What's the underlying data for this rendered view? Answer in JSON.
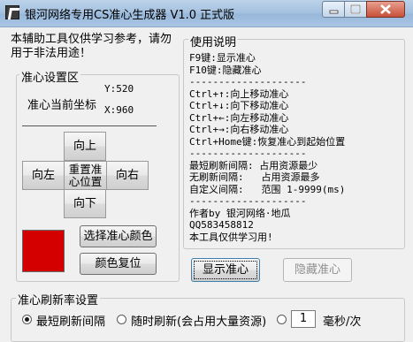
{
  "window": {
    "title": "银河网络专用CS准心生成器 V1.0 正式版"
  },
  "notice": "本辅助工具仅供学习参考，请勿用于非法用途！",
  "crosshair_group": {
    "title": "准心设置区",
    "coord_label": "准心当前坐标",
    "y_label": "Y:520",
    "x_label": "X:960",
    "btn_up": "向上",
    "btn_left": "向左",
    "btn_reset": "重置准心位置",
    "btn_right": "向右",
    "btn_down": "向下",
    "color_swatch": "#d40000",
    "btn_select_color": "选择准心颜色",
    "btn_color_reset": "颜色复位"
  },
  "usage_group": {
    "title": "使用说明",
    "lines": [
      "F9键:显示准心",
      "F10键:隐藏准心",
      "--------------------",
      "Ctrl+↑:向上移动准心",
      "Ctrl+↓:向下移动准心",
      "Ctrl+←:向左移动准心",
      "Ctrl+→:向右移动准心",
      "Ctrl+Home键:恢复准心到起始位置",
      "--------------------",
      "最短刷新间隔: 占用资源最少",
      "无刷新间隔:   占用资源最多",
      "自定义间隔:   范围 1-9999(ms)",
      "--------------------",
      "作者by 银河网络·地瓜",
      "QQ583458812",
      "本工具仅供学习用!"
    ]
  },
  "btn_show": "显示准心",
  "btn_hide": "隐藏准心",
  "refresh_group": {
    "title": "准心刷新率设置",
    "opt_shortest": "最短刷新间隔",
    "opt_random": "随时刷新(会占用大量资源)",
    "interval_value": "1",
    "unit": "毫秒/次"
  }
}
